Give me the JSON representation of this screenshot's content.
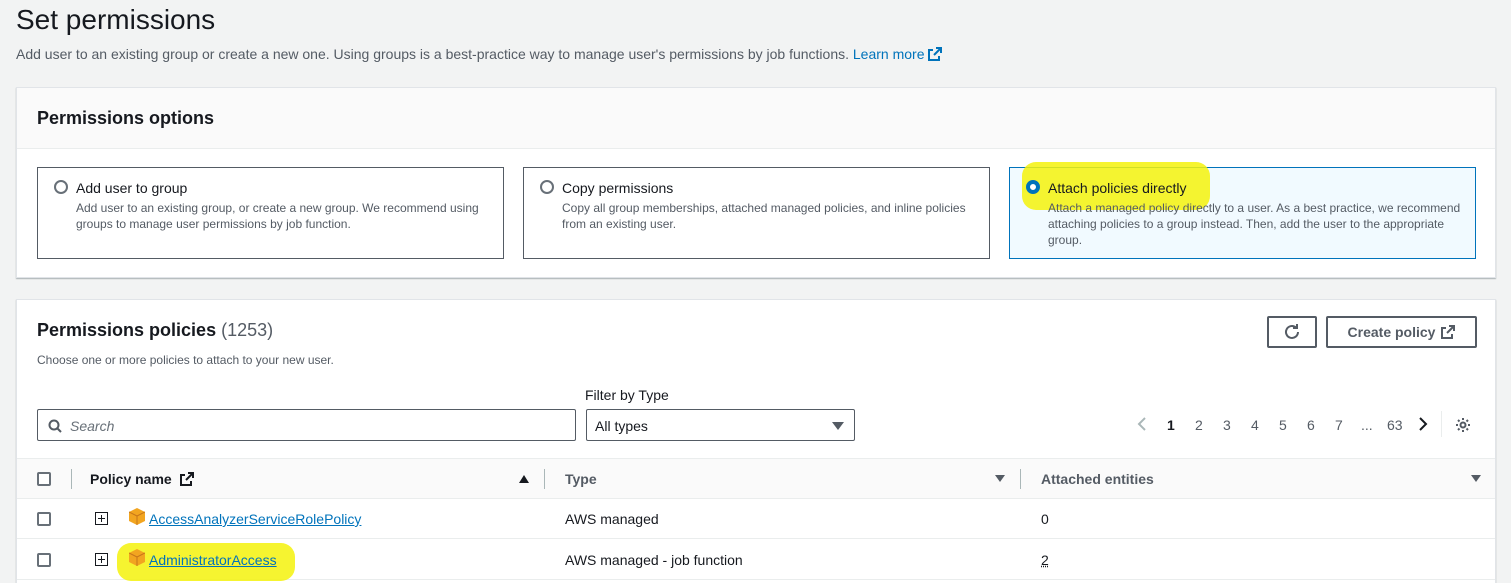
{
  "page": {
    "title": "Set permissions",
    "description": "Add user to an existing group or create a new one. Using groups is a best-practice way to manage user's permissions by job functions.",
    "learn_more": "Learn more"
  },
  "options_panel": {
    "title": "Permissions options",
    "options": [
      {
        "title": "Add user to group",
        "description": "Add user to an existing group, or create a new group. We recommend using groups to manage user permissions by job function.",
        "selected": false
      },
      {
        "title": "Copy permissions",
        "description": "Copy all group memberships, attached managed policies, and inline policies from an existing user.",
        "selected": false
      },
      {
        "title": "Attach policies directly",
        "description": "Attach a managed policy directly to a user. As a best practice, we recommend attaching policies to a group instead. Then, add the user to the appropriate group.",
        "selected": true
      }
    ]
  },
  "policies_panel": {
    "title": "Permissions policies",
    "count": "(1253)",
    "description": "Choose one or more policies to attach to your new user.",
    "create_policy": "Create policy",
    "search_placeholder": "Search",
    "filter_label": "Filter by Type",
    "filter_value": "All types",
    "pagination": {
      "pages": [
        "1",
        "2",
        "3",
        "4",
        "5",
        "6",
        "7",
        "...",
        "63"
      ],
      "current": "1"
    },
    "columns": [
      "Policy name",
      "Type",
      "Attached entities"
    ],
    "rows": [
      {
        "name": "AccessAnalyzerServiceRolePolicy",
        "type": "AWS managed",
        "entities": "0"
      },
      {
        "name": "AdministratorAccess",
        "type": "AWS managed - job function",
        "entities": "2"
      }
    ]
  },
  "colors": {
    "link": "#0073bb",
    "highlight": "#f5f20c",
    "selected_bg": "#f1faff",
    "cube": "#f2a520"
  },
  "icons": [
    "external-link-icon",
    "refresh-icon",
    "search-icon",
    "settings-icon",
    "chevron-left-icon",
    "chevron-right-icon",
    "cube-icon",
    "expand-icon"
  ]
}
